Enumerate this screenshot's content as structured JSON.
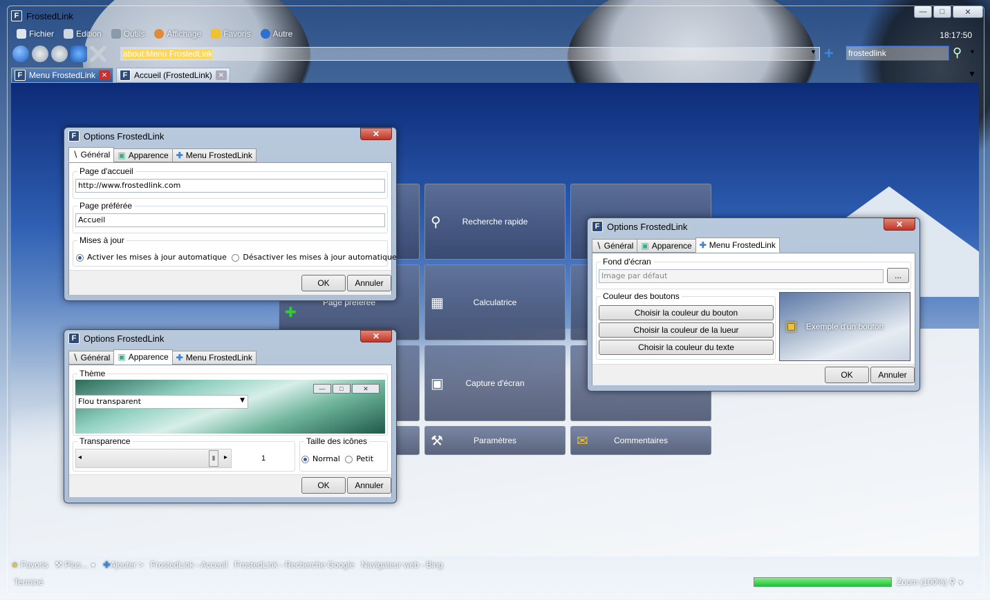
{
  "window": {
    "title": "FrostedLink",
    "app_icon": "F",
    "minimize": "—",
    "maximize": "□",
    "close": "✕"
  },
  "menu": [
    {
      "label": "Fichier",
      "icon": "file-icon"
    },
    {
      "label": "Edition",
      "icon": "edit-icon"
    },
    {
      "label": "Outils",
      "icon": "tools-icon"
    },
    {
      "label": "Affichage",
      "icon": "view-icon"
    },
    {
      "label": "Favoris",
      "icon": "star-icon"
    },
    {
      "label": "Autre",
      "icon": "help-icon"
    }
  ],
  "clock": "18:17:50",
  "address": {
    "value": "about:Menu FrostedLink",
    "dropdown": "▼"
  },
  "add_button": "+",
  "search": {
    "value": "frostedlink",
    "dropdown": "▾"
  },
  "tabs": [
    {
      "label": "Menu FrostedLink",
      "close": "✕"
    },
    {
      "label": "Accueil (FrostedLink)",
      "close": "✕"
    }
  ],
  "tab_menu": "▼",
  "tiles": [
    {
      "label": "Recherche rapide",
      "icon": "magnifier-icon"
    },
    {
      "label": "Page préférée",
      "icon": "add-page-icon"
    },
    {
      "label": "Calculatrice",
      "icon": "calculator-icon"
    },
    {
      "label": "Capture d'écran",
      "icon": "screenshot-icon"
    },
    {
      "label": "Paramètres",
      "icon": "tools-icon"
    },
    {
      "label": "Commentaires",
      "icon": "envelope-icon"
    }
  ],
  "dialog_general": {
    "title": "Options FrostedLink",
    "tabs": [
      "Général",
      "Apparence",
      "Menu FrostedLink"
    ],
    "home_label": "Page d'accueil",
    "home_value": "http://www.frostedlink.com",
    "pref_label": "Page préférée",
    "pref_value": "Accueil",
    "updates_label": "Mises à jour",
    "update_on": "Activer les mises à jour automatique",
    "update_off": "Désactiver les mises à jour automatique",
    "ok": "OK",
    "cancel": "Annuler"
  },
  "dialog_appearance": {
    "title": "Options FrostedLink",
    "tabs": [
      "Général",
      "Apparence",
      "Menu FrostedLink"
    ],
    "theme_label": "Thème",
    "theme_value": "Flou transparent",
    "transparency_label": "Transparence",
    "transparency_value": "1",
    "slider_left": "◂",
    "slider_right": "▸",
    "icon_size_label": "Taille des icônes",
    "size_normal": "Normal",
    "size_small": "Petit",
    "ok": "OK",
    "cancel": "Annuler"
  },
  "dialog_menu": {
    "title": "Options FrostedLink",
    "tabs": [
      "Général",
      "Apparence",
      "Menu FrostedLink"
    ],
    "wallpaper_label": "Fond d'écran",
    "wallpaper_placeholder": "Image par défaut",
    "browse": "...",
    "colors_label": "Couleur des boutons",
    "btn_color": "Choisir la couleur du bouton",
    "glow_color": "Choisir la couleur de la lueur",
    "text_color": "Choisir la couleur du texte",
    "example": "Exemple d'un bouton",
    "ok": "OK",
    "cancel": "Annuler"
  },
  "bookmarks": [
    "Favoris",
    "Plus...",
    "Ajouter >",
    "FrostedLink - Acceuil",
    "FrostedLink - Recherche Google",
    "Navigateur web - Bing"
  ],
  "status": {
    "text": "Terminé",
    "zoom": "Zoom (100%)",
    "progress": 1.0
  }
}
